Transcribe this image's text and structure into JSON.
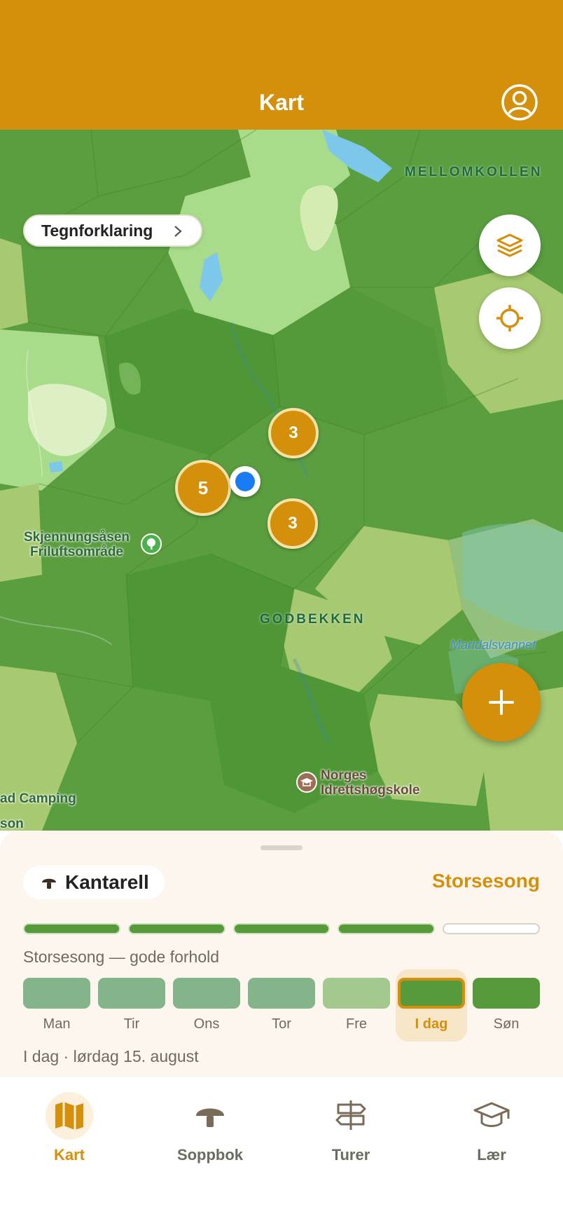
{
  "header": {
    "title": "Kart",
    "profile_icon": "person-circle-icon"
  },
  "map": {
    "legend_button": "Tegnforklaring",
    "layers_icon": "layers-icon",
    "locate_icon": "crosshair-icon",
    "clusters": [
      {
        "count": "3"
      },
      {
        "count": "5"
      },
      {
        "count": "3"
      }
    ],
    "labels": {
      "mellomkollen": "MELLOMKOLLEN",
      "godbekken": "GODBEKKEN",
      "maridalsvannet": "Maridalsvannet",
      "skjennung_line1": "Skjennungsåsen",
      "skjennung_line2": "Friluftsområde",
      "norges_line1": "Norges",
      "norges_line2": "Idrettshøgskole",
      "camping": "ad Camping",
      "partial": "son"
    },
    "add_icon": "plus-icon"
  },
  "sheet": {
    "species": "Kantarell",
    "species_icon": "mushroom-icon",
    "season": "Storsesong",
    "season_level": 4,
    "season_max": 5,
    "season_description": "Storsesong — gode forhold",
    "days": [
      {
        "label": "Man",
        "color": "#84b58a"
      },
      {
        "label": "Tir",
        "color": "#84b58a"
      },
      {
        "label": "Ons",
        "color": "#84b58a"
      },
      {
        "label": "Tor",
        "color": "#84b58a"
      },
      {
        "label": "Fre",
        "color": "#a3c98f"
      },
      {
        "label": "I dag",
        "color": "#579a3c",
        "today": true
      },
      {
        "label": "Søn",
        "color": "#579a3c"
      }
    ],
    "date_line": "I dag · lørdag 15. august"
  },
  "tabs": [
    {
      "label": "Kart",
      "icon": "map-icon",
      "active": true
    },
    {
      "label": "Soppbok",
      "icon": "mushroom-icon"
    },
    {
      "label": "Turer",
      "icon": "signpost-icon"
    },
    {
      "label": "Lær",
      "icon": "graduation-cap-icon"
    }
  ],
  "colors": {
    "accent": "#D4900A",
    "user_location": "#1a7cf5"
  }
}
